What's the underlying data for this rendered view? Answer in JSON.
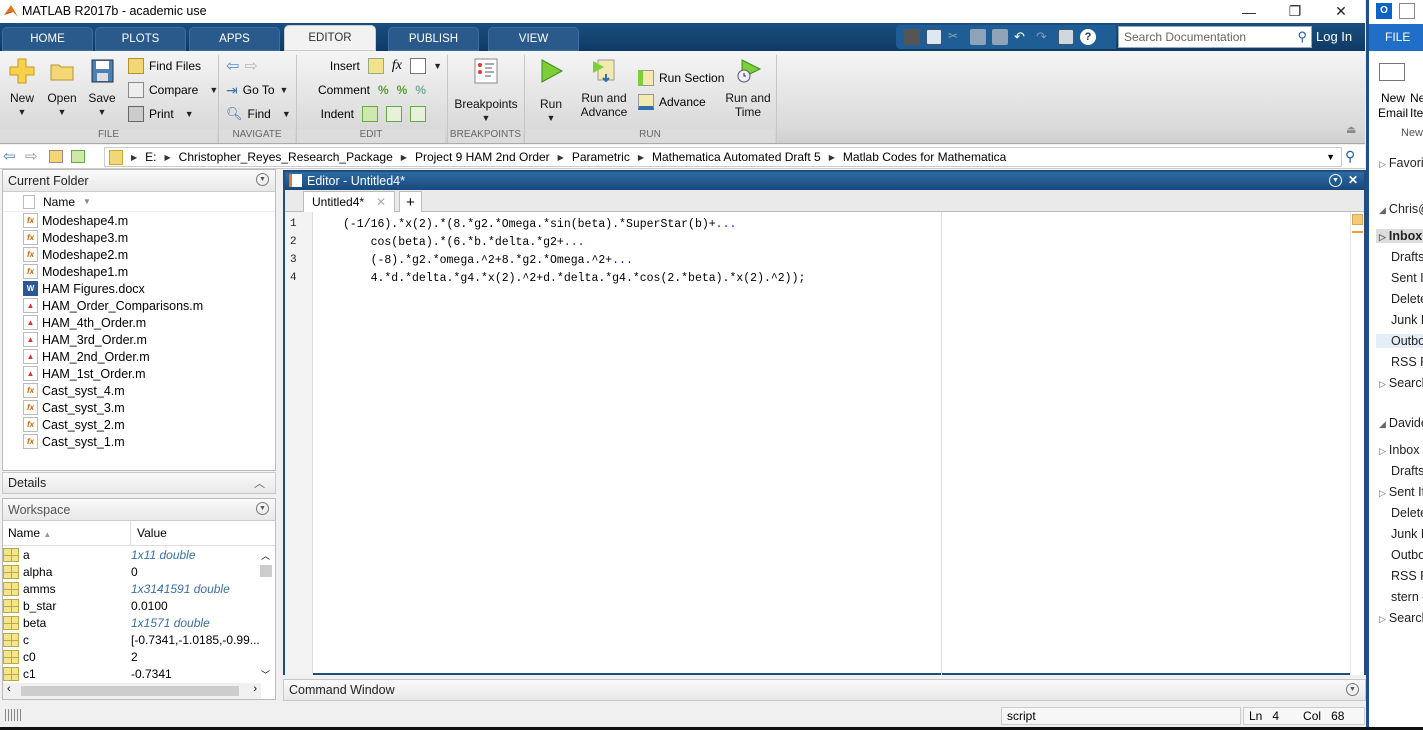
{
  "window": {
    "title": "MATLAB R2017b - academic use",
    "controls": {
      "minimize": "—",
      "restore": "❐",
      "close": "✕"
    }
  },
  "tabs": [
    {
      "label": "HOME",
      "active": false
    },
    {
      "label": "PLOTS",
      "active": false
    },
    {
      "label": "APPS",
      "active": false
    },
    {
      "label": "EDITOR",
      "active": true
    },
    {
      "label": "PUBLISH",
      "active": false
    },
    {
      "label": "VIEW",
      "active": false
    }
  ],
  "search": {
    "placeholder": "Search Documentation"
  },
  "login_label": "Log In",
  "ribbon": {
    "file": {
      "label": "FILE",
      "new": "New",
      "open": "Open",
      "save": "Save",
      "find_files": "Find Files",
      "compare": "Compare",
      "print": "Print"
    },
    "navigate": {
      "label": "NAVIGATE",
      "go_to": "Go To",
      "find": "Find"
    },
    "edit": {
      "label": "EDIT",
      "insert": "Insert",
      "comment": "Comment",
      "indent": "Indent",
      "fx": "fx"
    },
    "breakpoints": {
      "label": "BREAKPOINTS",
      "breakpoints": "Breakpoints"
    },
    "run": {
      "label": "RUN",
      "run": "Run",
      "run_and_advance": "Run and Advance",
      "run_section": "Run Section",
      "advance": "Advance",
      "run_and_time": "Run and Time"
    }
  },
  "address": {
    "crumbs": [
      "E:",
      "Christopher_Reyes_Research_Package",
      "Project 9 HAM 2nd Order",
      "Parametric",
      "Mathematica Automated Draft 5",
      "Matlab Codes for Mathematica"
    ]
  },
  "current_folder": {
    "title": "Current Folder",
    "column": "Name",
    "files": [
      {
        "name": "Modeshape4.m",
        "type": "function"
      },
      {
        "name": "Modeshape3.m",
        "type": "function"
      },
      {
        "name": "Modeshape2.m",
        "type": "function"
      },
      {
        "name": "Modeshape1.m",
        "type": "function"
      },
      {
        "name": "HAM Figures.docx",
        "type": "word"
      },
      {
        "name": "HAM_Order_Comparisons.m",
        "type": "script"
      },
      {
        "name": "HAM_4th_Order.m",
        "type": "script"
      },
      {
        "name": "HAM_3rd_Order.m",
        "type": "script"
      },
      {
        "name": "HAM_2nd_Order.m",
        "type": "script"
      },
      {
        "name": "HAM_1st_Order.m",
        "type": "script"
      },
      {
        "name": "Cast_syst_4.m",
        "type": "function"
      },
      {
        "name": "Cast_syst_3.m",
        "type": "function"
      },
      {
        "name": "Cast_syst_2.m",
        "type": "function"
      },
      {
        "name": "Cast_syst_1.m",
        "type": "function"
      }
    ]
  },
  "details": {
    "title": "Details"
  },
  "workspace": {
    "title": "Workspace",
    "columns": [
      "Name",
      "Value"
    ],
    "vars": [
      {
        "name": "a",
        "value": "1x11 double",
        "italic": true
      },
      {
        "name": "alpha",
        "value": "0",
        "italic": false
      },
      {
        "name": "amms",
        "value": "1x3141591 double",
        "italic": true
      },
      {
        "name": "b_star",
        "value": "0.0100",
        "italic": false
      },
      {
        "name": "beta",
        "value": "1x1571 double",
        "italic": true
      },
      {
        "name": "c",
        "value": "[-0.7341,-1.0185,-0.99...",
        "italic": false
      },
      {
        "name": "c0",
        "value": "2",
        "italic": false
      },
      {
        "name": "c1",
        "value": "-0.7341",
        "italic": false
      }
    ]
  },
  "editor": {
    "title": "Editor - Untitled4*",
    "tab": "Untitled4*",
    "add_tab": "+",
    "lines": [
      {
        "num": "1",
        "code": "(-1/16).*x(2).*(8.*g2.*Omega.*sin(beta).*SuperStar(b)+",
        "cont": "..."
      },
      {
        "num": "2",
        "code": "    cos(beta).*(6.*b.*delta.*g2+",
        "cont": "..."
      },
      {
        "num": "3",
        "code": "    (-8).*g2.*omega.^2+8.*g2.*Omega.^2+",
        "cont": "..."
      },
      {
        "num": "4",
        "code": "    4.*d.*delta.*g4.*x(2).^2+d.*delta.*g4.*cos(2.*beta).*x(2).^2));",
        "cont": ""
      }
    ]
  },
  "command_window": {
    "title": "Command Window"
  },
  "status": {
    "mode": "script",
    "ln_label": "Ln",
    "ln": "4",
    "col_label": "Col",
    "col": "68"
  },
  "outlook": {
    "file_tab": "FILE",
    "new_email": "New Email",
    "new_items": "New Items",
    "group_new": "New",
    "favorites": "Favorites",
    "account1": "Chris@",
    "account1_folders": [
      "Inbox",
      "Drafts",
      "Sent Items",
      "Deleted",
      "Junk E-mail",
      "Outbox",
      "RSS Feeds",
      "Search"
    ],
    "account2": "Davide",
    "account2_folders": [
      "Inbox",
      "Drafts",
      "Sent Items",
      "Deleted",
      "Junk E-mail",
      "Outbox",
      "RSS Feeds",
      "stern e",
      "Search"
    ]
  }
}
